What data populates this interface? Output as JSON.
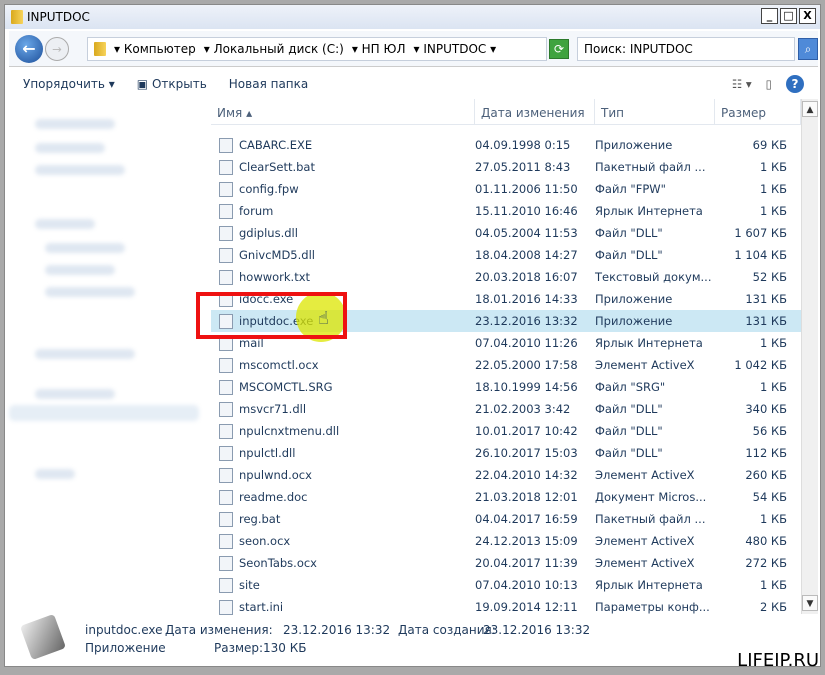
{
  "window": {
    "title": "INPUTDOC"
  },
  "nav": {
    "breadcrumb": [
      "Компьютер",
      "Локальный диск (C:)",
      "НП ЮЛ",
      "INPUTDOC"
    ],
    "search_placeholder": "Поиск: INPUTDOC"
  },
  "toolbar": {
    "organize": "Упорядочить",
    "open": "Открыть",
    "new_folder": "Новая папка"
  },
  "columns": {
    "name": "Имя",
    "date": "Дата изменения",
    "type": "Тип",
    "size": "Размер"
  },
  "files": [
    {
      "name": "CABARC.EXE",
      "date": "04.09.1998 0:15",
      "type": "Приложение",
      "size": "69 КБ"
    },
    {
      "name": "ClearSett.bat",
      "date": "27.05.2011 8:43",
      "type": "Пакетный файл ...",
      "size": "1 КБ"
    },
    {
      "name": "config.fpw",
      "date": "01.11.2006 11:50",
      "type": "Файл \"FPW\"",
      "size": "1 КБ"
    },
    {
      "name": "forum",
      "date": "15.11.2010 16:46",
      "type": "Ярлык Интернета",
      "size": "1 КБ"
    },
    {
      "name": "gdiplus.dll",
      "date": "04.05.2004 11:53",
      "type": "Файл \"DLL\"",
      "size": "1 607 КБ"
    },
    {
      "name": "GnivcMD5.dll",
      "date": "18.04.2008 14:27",
      "type": "Файл \"DLL\"",
      "size": "1 104 КБ"
    },
    {
      "name": "howwork.txt",
      "date": "20.03.2018 16:07",
      "type": "Текстовый докум...",
      "size": "52 КБ"
    },
    {
      "name": "idocc.exe",
      "date": "18.01.2016 14:33",
      "type": "Приложение",
      "size": "131 КБ"
    },
    {
      "name": "inputdoc.exe",
      "date": "23.12.2016 13:32",
      "type": "Приложение",
      "size": "131 КБ",
      "selected": true
    },
    {
      "name": "mail",
      "date": "07.04.2010 11:26",
      "type": "Ярлык Интернета",
      "size": "1 КБ"
    },
    {
      "name": "mscomctl.ocx",
      "date": "22.05.2000 17:58",
      "type": "Элемент ActiveX",
      "size": "1 042 КБ"
    },
    {
      "name": "MSCOMCTL.SRG",
      "date": "18.10.1999 14:56",
      "type": "Файл \"SRG\"",
      "size": "1 КБ"
    },
    {
      "name": "msvcr71.dll",
      "date": "21.02.2003 3:42",
      "type": "Файл \"DLL\"",
      "size": "340 КБ"
    },
    {
      "name": "npulcnxtmenu.dll",
      "date": "10.01.2017 10:42",
      "type": "Файл \"DLL\"",
      "size": "56 КБ"
    },
    {
      "name": "npulctl.dll",
      "date": "26.10.2017 15:03",
      "type": "Файл \"DLL\"",
      "size": "112 КБ"
    },
    {
      "name": "npulwnd.ocx",
      "date": "22.04.2010 14:32",
      "type": "Элемент ActiveX",
      "size": "260 КБ"
    },
    {
      "name": "readme.doc",
      "date": "21.03.2018 12:01",
      "type": "Документ Micros...",
      "size": "54 КБ"
    },
    {
      "name": "reg.bat",
      "date": "04.04.2017 16:59",
      "type": "Пакетный файл ...",
      "size": "1 КБ"
    },
    {
      "name": "seon.ocx",
      "date": "24.12.2013 15:09",
      "type": "Элемент ActiveX",
      "size": "480 КБ"
    },
    {
      "name": "SeonTabs.ocx",
      "date": "20.04.2017 11:39",
      "type": "Элемент ActiveX",
      "size": "272 КБ"
    },
    {
      "name": "site",
      "date": "07.04.2010 10:13",
      "type": "Ярлык Интернета",
      "size": "1 КБ"
    },
    {
      "name": "start.ini",
      "date": "19.09.2014 12:11",
      "type": "Параметры конф...",
      "size": "2 КБ"
    }
  ],
  "details": {
    "name": "inputdoc.exe",
    "modified_label": "Дата изменения:",
    "modified": "23.12.2016 13:32",
    "created_label": "Дата создания:",
    "created": "23.12.2016 13:32",
    "type": "Приложение",
    "size_label": "Размер:",
    "size": "130 КБ"
  },
  "watermark": "LIFEIP.RU",
  "colors": {
    "selection": "#cce8f4",
    "highlight_box": "#ee1111",
    "text": "#1e395b"
  }
}
